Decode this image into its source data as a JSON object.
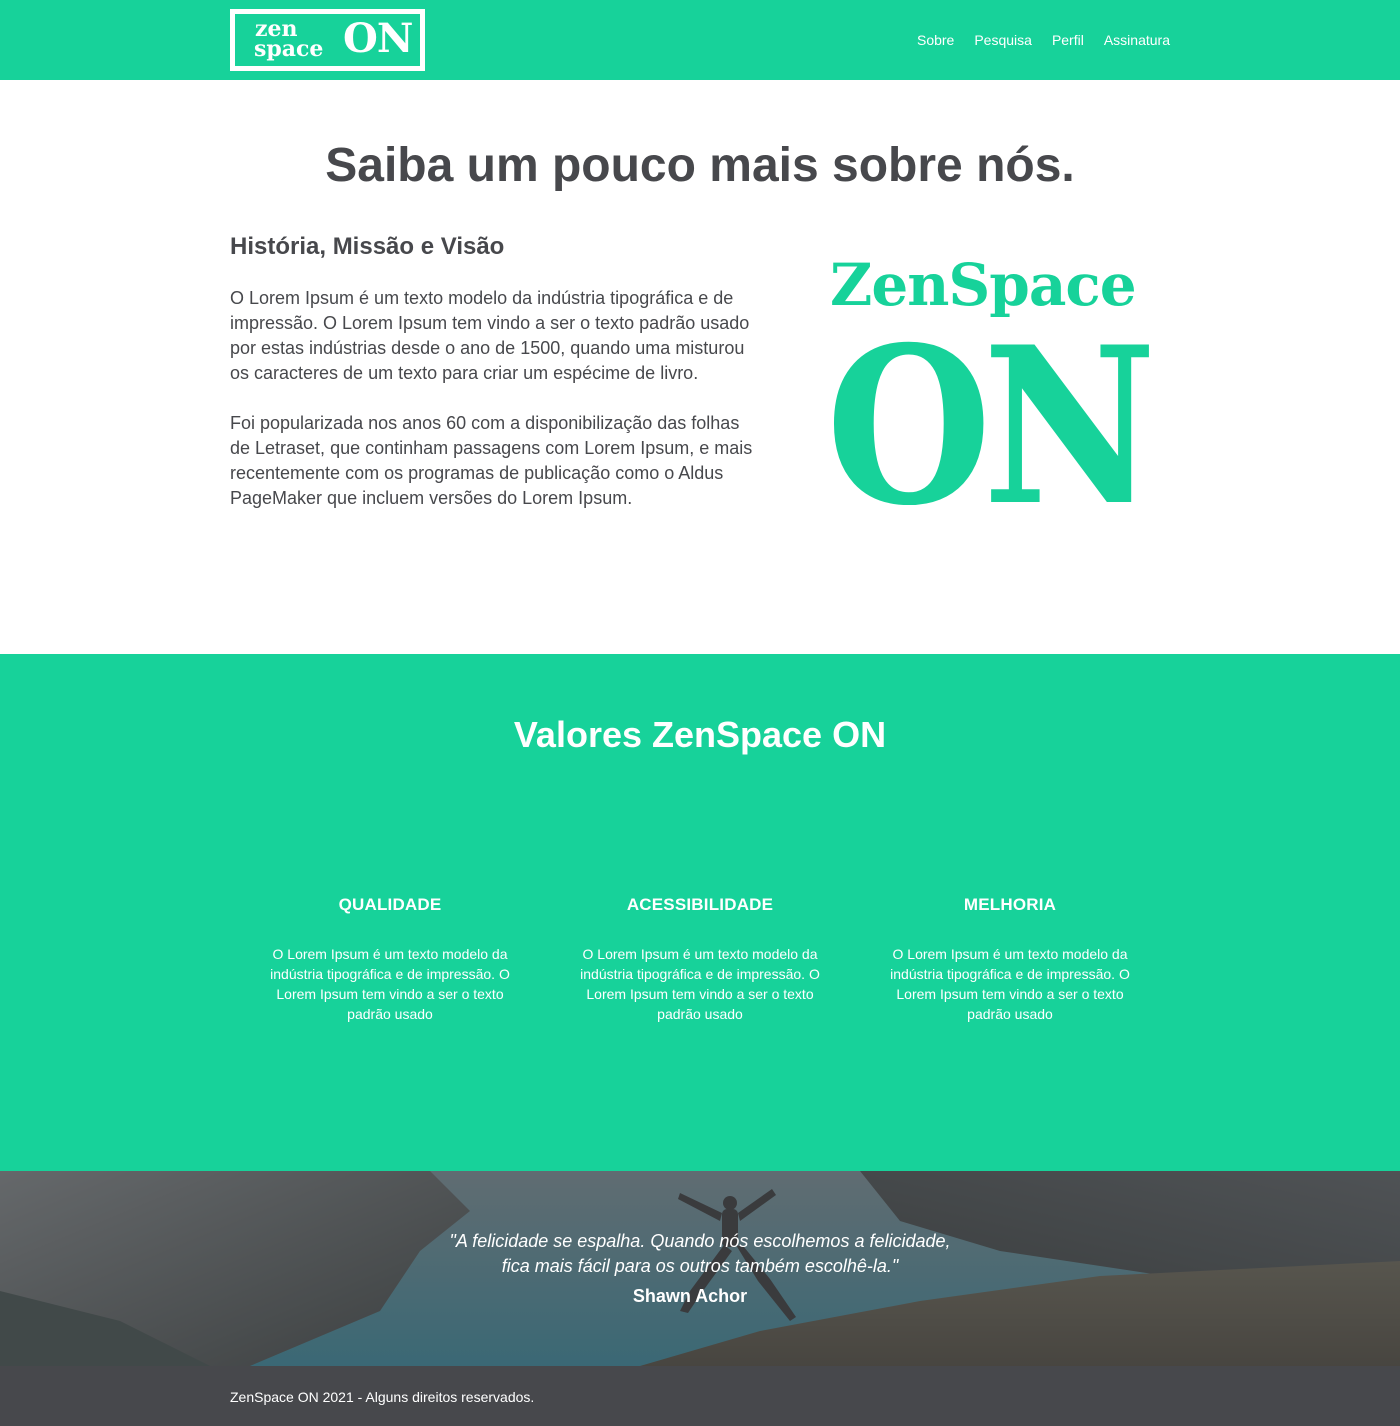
{
  "header": {
    "logo": {
      "line1": "zen",
      "line2": "space",
      "big": "ON"
    },
    "nav": [
      "Sobre",
      "Pesquisa",
      "Perfil",
      "Assinatura"
    ]
  },
  "about": {
    "title": "Saiba um pouco mais sobre nós.",
    "subtitle": "História, Missão e Visão",
    "paragraph1": "O Lorem Ipsum é um texto modelo da indústria tipográfica e de impressão. O Lorem Ipsum tem vindo a ser o texto padrão usado por estas indústrias desde o ano de 1500, quando uma misturou os caracteres de um texto para criar um espécime de livro.",
    "paragraph2": "Foi popularizada nos anos 60 com a disponibilização das folhas de Letraset, que continham passagens com Lorem Ipsum, e mais recentemente com os programas de publicação como o Aldus PageMaker que incluem versões do Lorem Ipsum.",
    "brand_line1": "ZenSpace",
    "brand_line2": "ON"
  },
  "values": {
    "title": "Valores ZenSpace ON",
    "items": [
      {
        "title": "QUALIDADE",
        "text": "O Lorem Ipsum é um texto modelo da indústria tipográfica e de impressão. O Lorem Ipsum tem vindo a ser o texto padrão usado"
      },
      {
        "title": "ACESSIBILIDADE",
        "text": "O Lorem Ipsum é um texto modelo da indústria tipográfica e de impressão. O Lorem Ipsum tem vindo a ser o texto padrão usado"
      },
      {
        "title": "MELHORIA",
        "text": "O Lorem Ipsum é um texto modelo da indústria tipográfica e de impressão. O Lorem Ipsum tem vindo a ser o texto padrão usado"
      }
    ]
  },
  "quote": {
    "line1": "\"A felicidade se espalha. Quando nós escolhemos a felicidade,",
    "line2": "fica mais fácil para os outros também escolhê-la.\"",
    "author": "Shawn Achor"
  },
  "footer": {
    "text": "ZenSpace ON 2021 - Alguns direitos reservados."
  },
  "colors": {
    "accent": "#17d29a",
    "text": "#47484c",
    "footer": "#47484c"
  }
}
